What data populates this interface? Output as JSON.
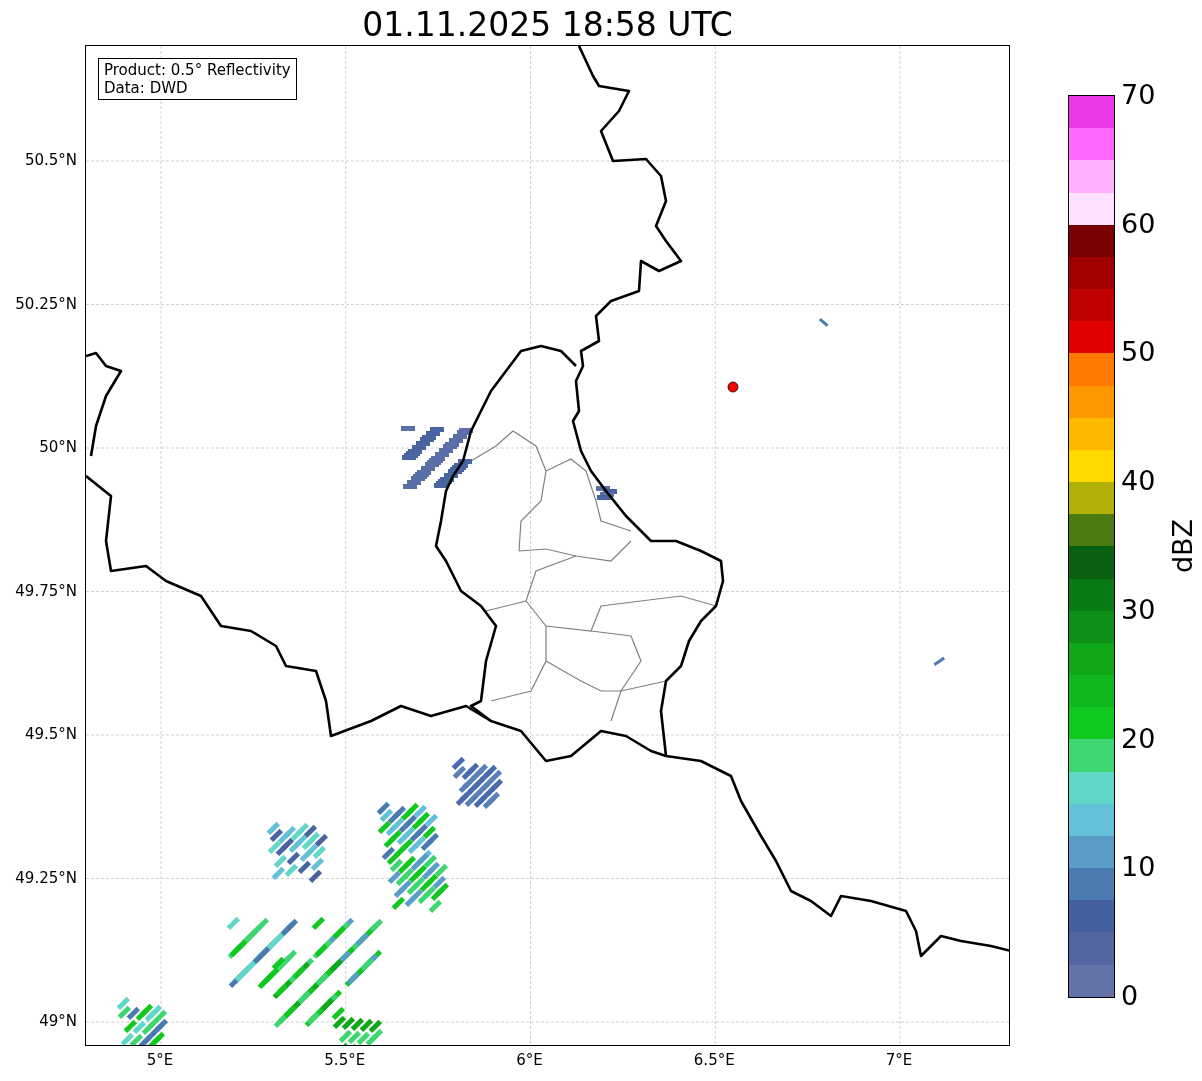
{
  "title": "01.11.2025 18:58 UTC",
  "map": {
    "info": [
      "Product: 0.5° Reflectivity",
      "Data: DWD"
    ],
    "yticks": [
      "50.5°N",
      "50.25°N",
      "50°N",
      "49.75°N",
      "49.5°N",
      "49.25°N",
      "49°N"
    ],
    "xticks": [
      "5°E",
      "5.5°E",
      "6°E",
      "6.5°E",
      "7°E"
    ]
  },
  "colorbar": {
    "label": "dBZ",
    "ticks": [
      "70",
      "60",
      "50",
      "40",
      "30",
      "20",
      "10",
      "0"
    ],
    "segments": [
      {
        "color": "#e838e8"
      },
      {
        "color": "#ff68ff"
      },
      {
        "color": "#ffb0ff"
      },
      {
        "color": "#ffe0ff"
      },
      {
        "color": "#780000"
      },
      {
        "color": "#a00000"
      },
      {
        "color": "#c00000"
      },
      {
        "color": "#e00000"
      },
      {
        "color": "#ff7800"
      },
      {
        "color": "#ff9800"
      },
      {
        "color": "#ffb800"
      },
      {
        "color": "#ffd800"
      },
      {
        "color": "#b0b008"
      },
      {
        "color": "#4a7a10"
      },
      {
        "color": "#086010"
      },
      {
        "color": "#0a7a14"
      },
      {
        "color": "#0e9018"
      },
      {
        "color": "#10a818"
      },
      {
        "color": "#10b820"
      },
      {
        "color": "#10c820"
      },
      {
        "color": "#3dd670"
      },
      {
        "color": "#60d8c8"
      },
      {
        "color": "#62c0d8"
      },
      {
        "color": "#5a9ec8"
      },
      {
        "color": "#4a7ab0"
      },
      {
        "color": "#4560a0"
      },
      {
        "color": "#5366a0"
      },
      {
        "color": "#6373a8"
      }
    ]
  }
}
